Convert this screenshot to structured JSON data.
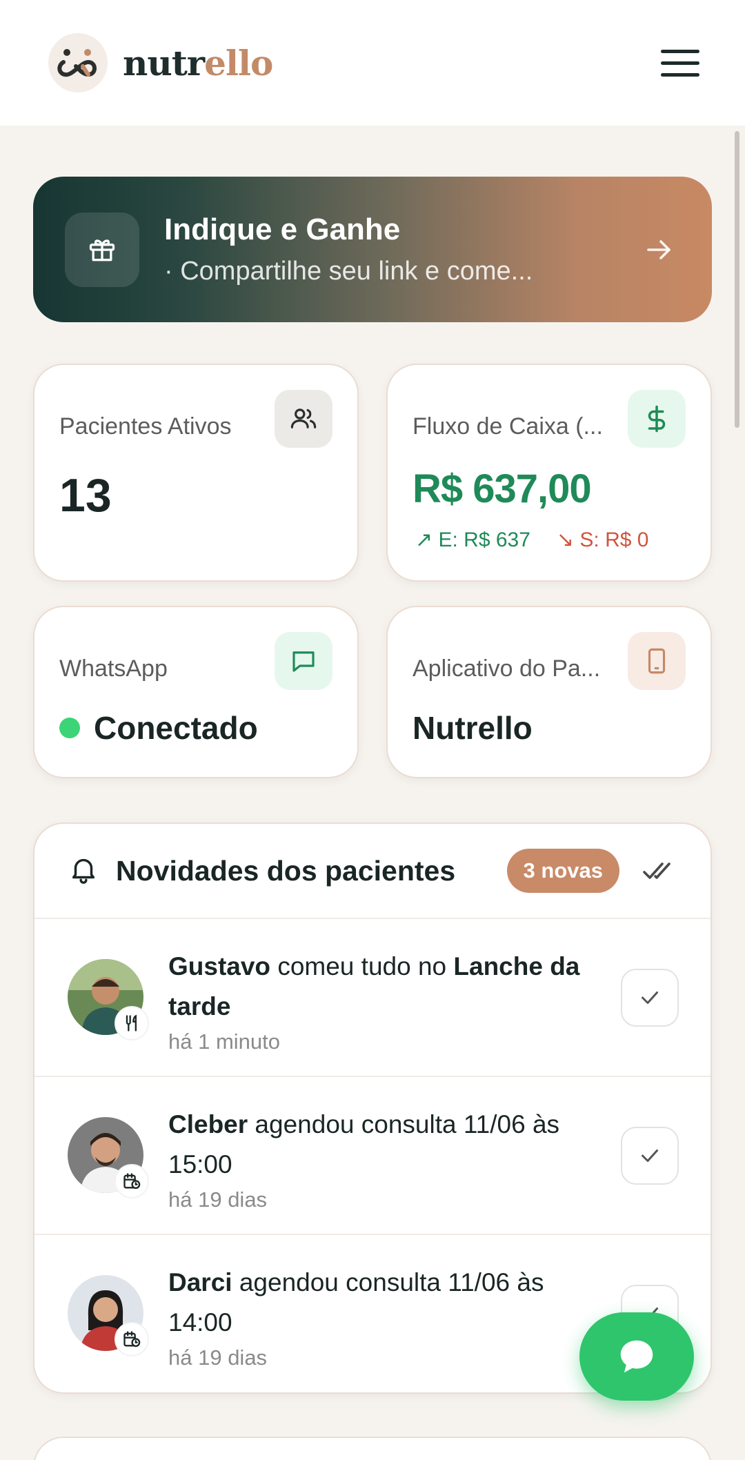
{
  "header": {
    "brand_part1": "nutr",
    "brand_part2": "ello",
    "menu_icon": "hamburger-menu-icon"
  },
  "referral": {
    "title": "Indique e Ganhe",
    "subtitle": "· Compartilhe seu link e come...",
    "icon": "gift-icon"
  },
  "stats": {
    "patients": {
      "label": "Pacientes Ativos",
      "value": "13",
      "icon": "users-icon"
    },
    "cashflow": {
      "label": "Fluxo de Caixa (...",
      "value": "R$ 637,00",
      "income": "E: R$ 637",
      "expense": "S: R$ 0",
      "icon": "dollar-icon"
    },
    "whatsapp": {
      "label": "WhatsApp",
      "value": "Conectado",
      "icon": "chat-icon"
    },
    "app": {
      "label": "Aplicativo do Pa...",
      "value": "Nutrello",
      "icon": "phone-icon"
    }
  },
  "news": {
    "title": "Novidades dos pacientes",
    "badge": "3 novas",
    "items": [
      {
        "name": "Gustavo",
        "text": " comeu tudo no ",
        "bold2": "Lanche da tarde",
        "time": "há 1 minuto",
        "tag_icon": "cutlery-icon"
      },
      {
        "name": "Cleber",
        "text": " agendou consulta 11/06 às 15:00",
        "bold2": "",
        "time": "há 19 dias",
        "tag_icon": "calendar-icon"
      },
      {
        "name": "Darci",
        "text": " agendou consulta 11/06 às 14:00",
        "bold2": "",
        "time": "há 19 dias",
        "tag_icon": "calendar-icon"
      }
    ]
  },
  "colors": {
    "accent_green": "#1f8a58",
    "accent_peach": "#c98a67",
    "dark_teal": "#173633"
  }
}
